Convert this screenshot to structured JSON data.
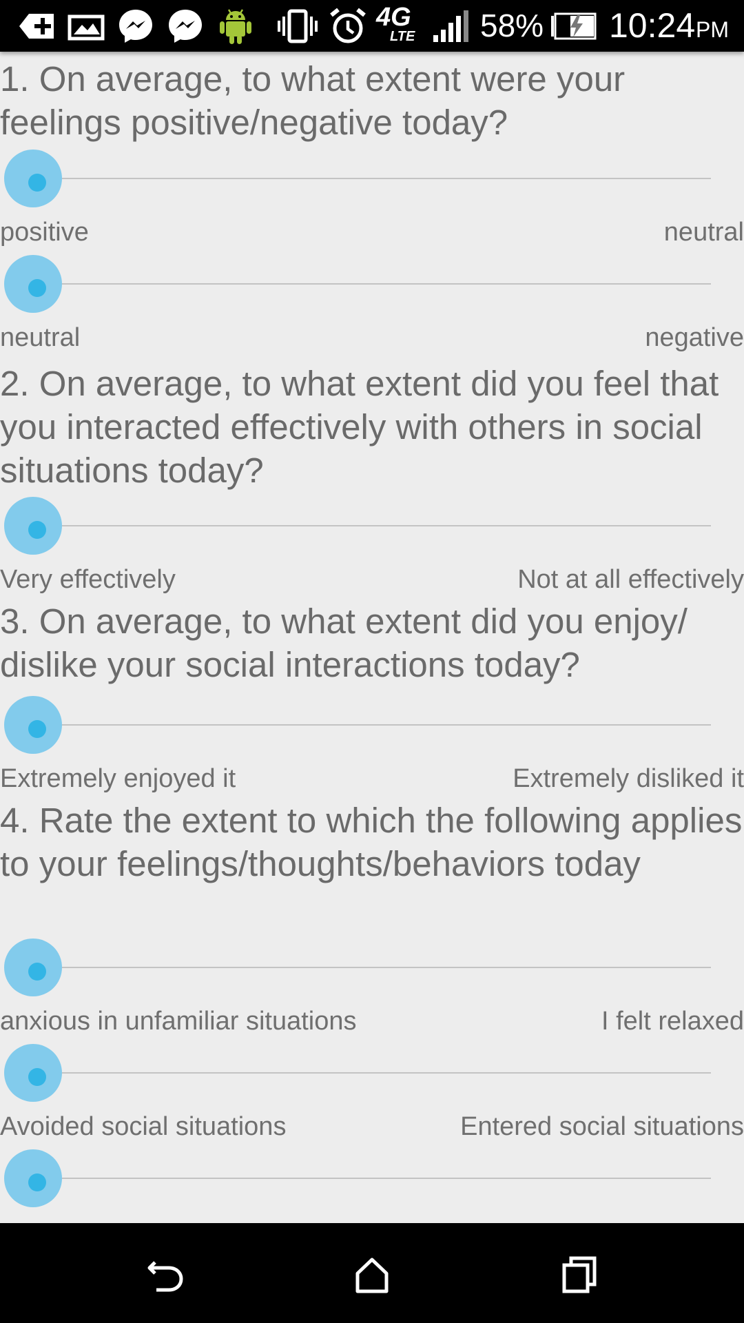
{
  "status_bar": {
    "icons": [
      "add-box-icon",
      "photo-icon",
      "messenger-icon",
      "messenger-icon",
      "android-icon",
      "vibrate-icon",
      "alarm-icon",
      "4g-lte-icon",
      "signal-icon",
      "battery-charging-icon"
    ],
    "network": "4G",
    "network_sub": "LTE",
    "battery_percent": "58%",
    "time": "10:24",
    "ampm": "PM"
  },
  "questions": [
    {
      "text": "1. On average, to what extent were your feelings positive/negative today?",
      "sliders": [
        {
          "left_label": "positive",
          "right_label": "neutral",
          "value": 0
        },
        {
          "left_label": "neutral",
          "right_label": "negative",
          "value": 0
        }
      ]
    },
    {
      "text": "2. On average, to what extent did you feel that you interacted effectively with others in social situations today?",
      "sliders": [
        {
          "left_label": "Very effectively",
          "right_label": "Not at all effectively",
          "value": 0
        }
      ]
    },
    {
      "text": "3. On average, to what extent did you enjoy/ dislike your social interactions today?",
      "sliders": [
        {
          "left_label": "Extremely enjoyed it",
          "right_label": "Extremely disliked it",
          "value": 0
        }
      ]
    },
    {
      "text": "4. Rate the extent to which the following applies to your feelings/thoughts/behaviors today",
      "sliders": [
        {
          "left_label": "anxious in unfamiliar situations",
          "right_label": "I felt relaxed",
          "value": 0
        },
        {
          "left_label": "Avoided social situations",
          "right_label": "Entered social situations",
          "value": 0
        },
        {
          "left_label": "",
          "right_label": "",
          "value": 0
        }
      ]
    }
  ],
  "nav_bar": {
    "buttons": [
      "back-icon",
      "home-icon",
      "recents-icon"
    ]
  },
  "colors": {
    "slider_thumb": "#82cbec",
    "slider_thumb_center": "#33b5e5",
    "background": "#ededed"
  }
}
